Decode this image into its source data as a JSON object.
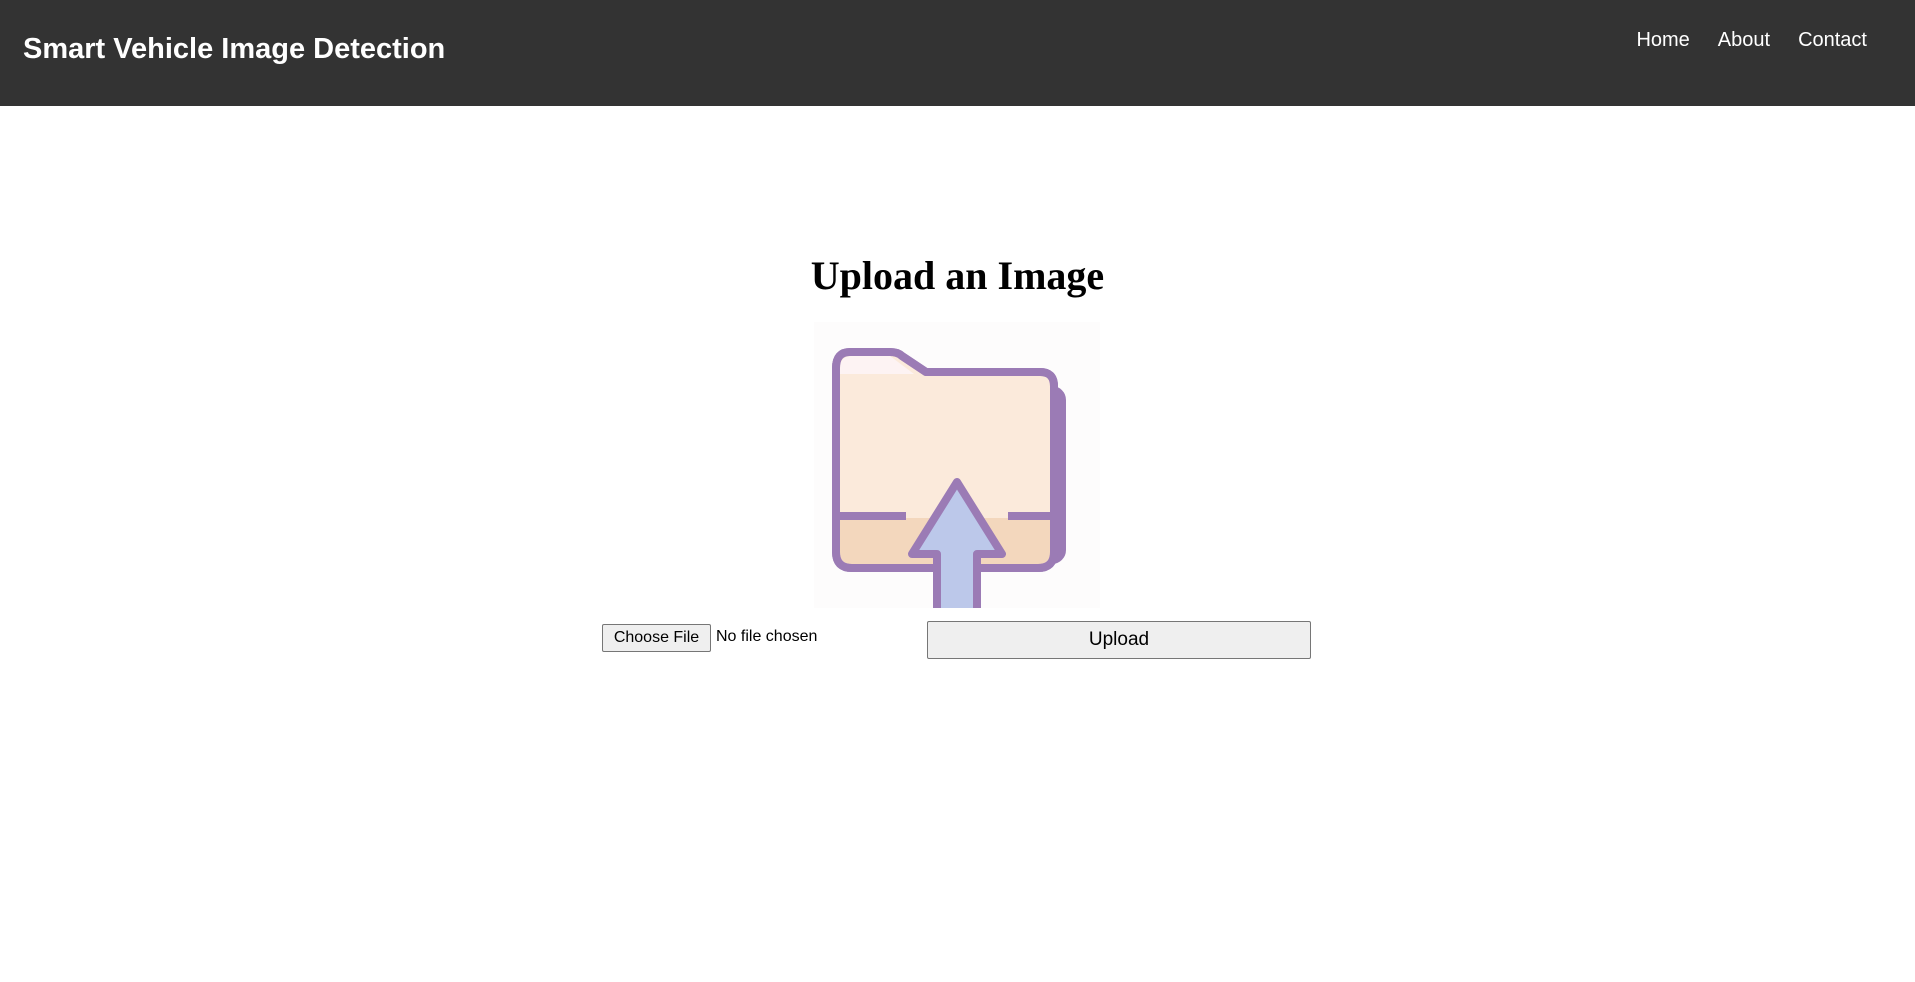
{
  "header": {
    "brand": "Smart Vehicle Image Detection",
    "nav": [
      {
        "label": "Home"
      },
      {
        "label": "About"
      },
      {
        "label": "Contact"
      }
    ],
    "background_color": "#333333",
    "text_color": "#ffffff"
  },
  "main": {
    "title": "Upload an Image",
    "illustration_icon": "folder-upload-icon",
    "file_input": {
      "button_label": "Choose File",
      "status_text": "No file chosen"
    },
    "upload_button_label": "Upload"
  },
  "colors": {
    "folder_outline": "#9b7bb5",
    "folder_fill": "#fbeadb",
    "folder_tab": "#f3d7bd",
    "arrow_fill": "#bcc8ea",
    "folder_back": "#d8a3a8"
  }
}
